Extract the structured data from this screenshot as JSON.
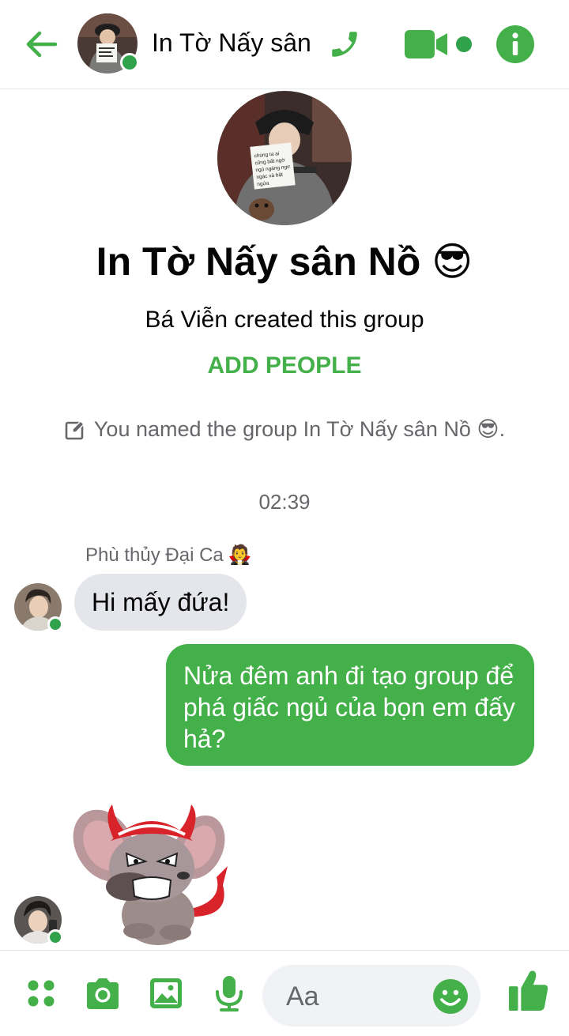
{
  "header": {
    "title": "In Tờ Nấy sân",
    "icons": {
      "back": "arrow-left-icon",
      "call": "phone-icon",
      "video": "video-camera-icon",
      "info": "info-icon"
    }
  },
  "group": {
    "name": "In Tờ Nấy sân Nồ 😎",
    "created_by": "Bá Viễn created this group",
    "add_people_label": "ADD PEOPLE",
    "photo_sign_text": "chúng ta ai cũng bất ngờ ngủ ngáng ngơ ngác và bật ngửa"
  },
  "events": {
    "rename_notice": "You named the group In Tờ Nấy sân Nồ 😎.",
    "timestamp": "02:39"
  },
  "messages": {
    "sender_name": "Phù thủy Đại Ca",
    "sender_emoji": "🧛",
    "incoming_text": "Hi mấy đứa!",
    "outgoing_text": "Nửa đêm anh đi tạo group để phá giấc ngủ của bọn em đấy hả?",
    "sticker": "angry-devil-mouse-sticker"
  },
  "composer": {
    "placeholder": "Aa",
    "icons": [
      "apps-icon",
      "camera-icon",
      "image-icon",
      "microphone-icon",
      "emoji-icon",
      "thumbs-up-icon"
    ]
  },
  "colors": {
    "accent": "#44b04a",
    "online": "#31a24c",
    "bubble_in": "#e4e6eb",
    "secondary_text": "#65676b"
  }
}
